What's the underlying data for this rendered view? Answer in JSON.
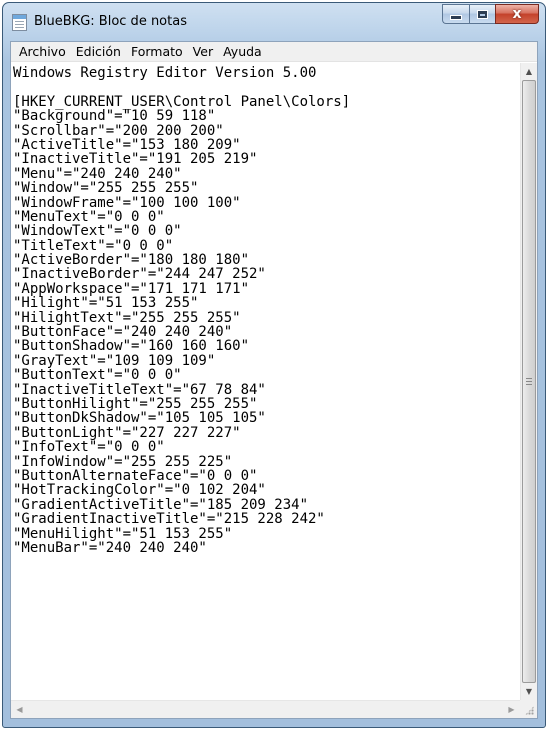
{
  "window": {
    "title": "BlueBKG: Bloc de notas",
    "icon": "notepad-icon",
    "buttons": {
      "minimize_icon": "minimize-icon",
      "maximize_icon": "maximize-icon",
      "close_icon": "close-icon",
      "close_glyph": "x"
    }
  },
  "menubar": {
    "items": [
      "Archivo",
      "Edición",
      "Formato",
      "Ver",
      "Ayuda"
    ]
  },
  "editor": {
    "lines": [
      "Windows Registry Editor Version 5.00",
      "",
      "[HKEY_CURRENT_USER\\Control Panel\\Colors]",
      "\"Background\"=\"10 59 118\"",
      "\"Scrollbar\"=\"200 200 200\"",
      "\"ActiveTitle\"=\"153 180 209\"",
      "\"InactiveTitle\"=\"191 205 219\"",
      "\"Menu\"=\"240 240 240\"",
      "\"Window\"=\"255 255 255\"",
      "\"WindowFrame\"=\"100 100 100\"",
      "\"MenuText\"=\"0 0 0\"",
      "\"WindowText\"=\"0 0 0\"",
      "\"TitleText\"=\"0 0 0\"",
      "\"ActiveBorder\"=\"180 180 180\"",
      "\"InactiveBorder\"=\"244 247 252\"",
      "\"AppWorkspace\"=\"171 171 171\"",
      "\"Hilight\"=\"51 153 255\"",
      "\"HilightText\"=\"255 255 255\"",
      "\"ButtonFace\"=\"240 240 240\"",
      "\"ButtonShadow\"=\"160 160 160\"",
      "\"GrayText\"=\"109 109 109\"",
      "\"ButtonText\"=\"0 0 0\"",
      "\"InactiveTitleText\"=\"67 78 84\"",
      "\"ButtonHilight\"=\"255 255 255\"",
      "\"ButtonDkShadow\"=\"105 105 105\"",
      "\"ButtonLight\"=\"227 227 227\"",
      "\"InfoText\"=\"0 0 0\"",
      "\"InfoWindow\"=\"255 255 225\"",
      "\"ButtonAlternateFace\"=\"0 0 0\"",
      "\"HotTrackingColor\"=\"0 102 204\"",
      "\"GradientActiveTitle\"=\"185 209 234\"",
      "\"GradientInactiveTitle\"=\"215 228 242\"",
      "\"MenuHilight\"=\"51 153 255\"",
      "\"MenuBar\"=\"240 240 240\""
    ]
  },
  "scrollbars": {
    "up_arrow": "▲",
    "down_arrow": "▼",
    "left_arrow": "◀",
    "right_arrow": "▶"
  },
  "colors": {
    "close_button": "#c4412a",
    "frame": "#a9c4e0"
  }
}
